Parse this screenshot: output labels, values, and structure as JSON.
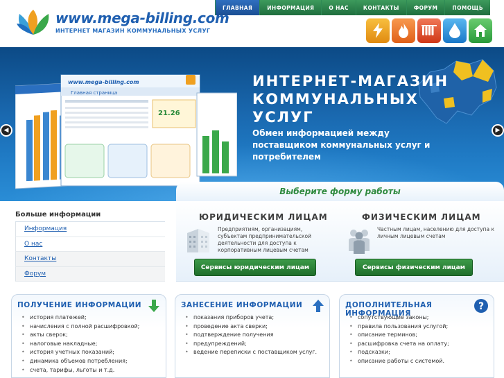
{
  "logo": {
    "title": "www.mega-billing.com",
    "subtitle": "ИНТЕРНЕТ МАГАЗИН КОММУНАЛЬНЫХ УСЛУГ"
  },
  "nav": [
    "ГЛАВНАЯ",
    "ИНФОРМАЦИЯ",
    "О НАС",
    "КОНТАКТЫ",
    "ФОРУМ",
    "ПОМОЩЬ"
  ],
  "utility_icons": [
    {
      "name": "electricity-icon",
      "color": "#f0a020"
    },
    {
      "name": "gas-flame-icon",
      "color": "#f07020"
    },
    {
      "name": "heating-radiator-icon",
      "color": "#e85030"
    },
    {
      "name": "water-drop-icon",
      "color": "#2a8fd6"
    },
    {
      "name": "house-icon",
      "color": "#3aa84a"
    }
  ],
  "banner": {
    "title_line1": "ИНТЕРНЕТ-МАГАЗИН",
    "title_line2": "КОММУНАЛЬНЫХ УСЛУГ",
    "text": "Обмен информацией между поставщиком коммунальных услуг и потребителем",
    "screen_logo": "www.mega-billing.com",
    "screen_heading": "Главная страница",
    "screen_price": "21.26"
  },
  "choose": {
    "title": "Выберите форму работы",
    "legal": {
      "heading": "ЮРИДИЧЕСКИМ ЛИЦАМ",
      "desc": "Предприятиям, организациям, субъектам предпринимательской деятельности для доступа к корпоративным лицевым счетам",
      "button": "Сервисы юридическим лицам"
    },
    "physical": {
      "heading": "ФИЗИЧЕСКИМ ЛИЦАМ",
      "desc": "Частным лицам, населению для доступа к личным лицевым счетам",
      "button": "Сервисы физическим лицам"
    }
  },
  "more": {
    "title": "Больше информации",
    "links": [
      "Информация",
      "О нас",
      "Контакты",
      "Форум"
    ]
  },
  "cards": [
    {
      "title": "ПОЛУЧЕНИЕ ИНФОРМАЦИИ",
      "icon": "green-down-arrow-icon",
      "items": [
        "история платежей;",
        "начисления с полной расшифровкой;",
        "акты сверок;",
        "налоговые накладные;",
        "история учетных показаний;",
        "динамика объемов потребления;",
        "счета, тарифы, льготы и т.д."
      ]
    },
    {
      "title": "ЗАНЕСЕНИЕ ИНФОРМАЦИИ",
      "icon": "blue-up-arrow-icon",
      "items": [
        "показания приборов учета;",
        "проведение акта сверки;",
        "подтверждение получения",
        "предупреждений;",
        "ведение переписки с поставщиком услуг."
      ]
    },
    {
      "title": "ДОПОЛНИТЕЛЬНАЯ ИНФОРМАЦИЯ",
      "icon": "question-mark-icon",
      "items": [
        "сопутствующие законы;",
        "правила пользования услугой;",
        "описание терминов;",
        "расшифровка счета на оплату;",
        "подсказки;",
        "описание работы с системой."
      ]
    }
  ]
}
